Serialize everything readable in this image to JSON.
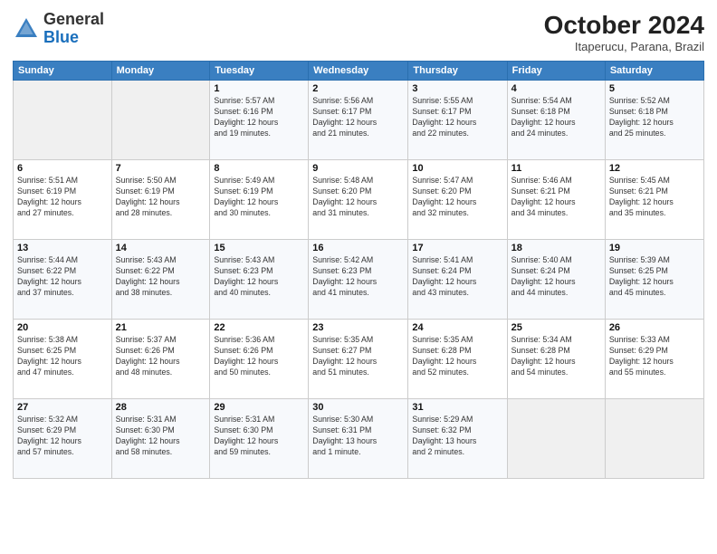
{
  "header": {
    "logo_general": "General",
    "logo_blue": "Blue",
    "month_year": "October 2024",
    "location": "Itaperucu, Parana, Brazil"
  },
  "weekdays": [
    "Sunday",
    "Monday",
    "Tuesday",
    "Wednesday",
    "Thursday",
    "Friday",
    "Saturday"
  ],
  "weeks": [
    [
      {
        "day": "",
        "info": ""
      },
      {
        "day": "",
        "info": ""
      },
      {
        "day": "1",
        "info": "Sunrise: 5:57 AM\nSunset: 6:16 PM\nDaylight: 12 hours\nand 19 minutes."
      },
      {
        "day": "2",
        "info": "Sunrise: 5:56 AM\nSunset: 6:17 PM\nDaylight: 12 hours\nand 21 minutes."
      },
      {
        "day": "3",
        "info": "Sunrise: 5:55 AM\nSunset: 6:17 PM\nDaylight: 12 hours\nand 22 minutes."
      },
      {
        "day": "4",
        "info": "Sunrise: 5:54 AM\nSunset: 6:18 PM\nDaylight: 12 hours\nand 24 minutes."
      },
      {
        "day": "5",
        "info": "Sunrise: 5:52 AM\nSunset: 6:18 PM\nDaylight: 12 hours\nand 25 minutes."
      }
    ],
    [
      {
        "day": "6",
        "info": "Sunrise: 5:51 AM\nSunset: 6:19 PM\nDaylight: 12 hours\nand 27 minutes."
      },
      {
        "day": "7",
        "info": "Sunrise: 5:50 AM\nSunset: 6:19 PM\nDaylight: 12 hours\nand 28 minutes."
      },
      {
        "day": "8",
        "info": "Sunrise: 5:49 AM\nSunset: 6:19 PM\nDaylight: 12 hours\nand 30 minutes."
      },
      {
        "day": "9",
        "info": "Sunrise: 5:48 AM\nSunset: 6:20 PM\nDaylight: 12 hours\nand 31 minutes."
      },
      {
        "day": "10",
        "info": "Sunrise: 5:47 AM\nSunset: 6:20 PM\nDaylight: 12 hours\nand 32 minutes."
      },
      {
        "day": "11",
        "info": "Sunrise: 5:46 AM\nSunset: 6:21 PM\nDaylight: 12 hours\nand 34 minutes."
      },
      {
        "day": "12",
        "info": "Sunrise: 5:45 AM\nSunset: 6:21 PM\nDaylight: 12 hours\nand 35 minutes."
      }
    ],
    [
      {
        "day": "13",
        "info": "Sunrise: 5:44 AM\nSunset: 6:22 PM\nDaylight: 12 hours\nand 37 minutes."
      },
      {
        "day": "14",
        "info": "Sunrise: 5:43 AM\nSunset: 6:22 PM\nDaylight: 12 hours\nand 38 minutes."
      },
      {
        "day": "15",
        "info": "Sunrise: 5:43 AM\nSunset: 6:23 PM\nDaylight: 12 hours\nand 40 minutes."
      },
      {
        "day": "16",
        "info": "Sunrise: 5:42 AM\nSunset: 6:23 PM\nDaylight: 12 hours\nand 41 minutes."
      },
      {
        "day": "17",
        "info": "Sunrise: 5:41 AM\nSunset: 6:24 PM\nDaylight: 12 hours\nand 43 minutes."
      },
      {
        "day": "18",
        "info": "Sunrise: 5:40 AM\nSunset: 6:24 PM\nDaylight: 12 hours\nand 44 minutes."
      },
      {
        "day": "19",
        "info": "Sunrise: 5:39 AM\nSunset: 6:25 PM\nDaylight: 12 hours\nand 45 minutes."
      }
    ],
    [
      {
        "day": "20",
        "info": "Sunrise: 5:38 AM\nSunset: 6:25 PM\nDaylight: 12 hours\nand 47 minutes."
      },
      {
        "day": "21",
        "info": "Sunrise: 5:37 AM\nSunset: 6:26 PM\nDaylight: 12 hours\nand 48 minutes."
      },
      {
        "day": "22",
        "info": "Sunrise: 5:36 AM\nSunset: 6:26 PM\nDaylight: 12 hours\nand 50 minutes."
      },
      {
        "day": "23",
        "info": "Sunrise: 5:35 AM\nSunset: 6:27 PM\nDaylight: 12 hours\nand 51 minutes."
      },
      {
        "day": "24",
        "info": "Sunrise: 5:35 AM\nSunset: 6:28 PM\nDaylight: 12 hours\nand 52 minutes."
      },
      {
        "day": "25",
        "info": "Sunrise: 5:34 AM\nSunset: 6:28 PM\nDaylight: 12 hours\nand 54 minutes."
      },
      {
        "day": "26",
        "info": "Sunrise: 5:33 AM\nSunset: 6:29 PM\nDaylight: 12 hours\nand 55 minutes."
      }
    ],
    [
      {
        "day": "27",
        "info": "Sunrise: 5:32 AM\nSunset: 6:29 PM\nDaylight: 12 hours\nand 57 minutes."
      },
      {
        "day": "28",
        "info": "Sunrise: 5:31 AM\nSunset: 6:30 PM\nDaylight: 12 hours\nand 58 minutes."
      },
      {
        "day": "29",
        "info": "Sunrise: 5:31 AM\nSunset: 6:30 PM\nDaylight: 12 hours\nand 59 minutes."
      },
      {
        "day": "30",
        "info": "Sunrise: 5:30 AM\nSunset: 6:31 PM\nDaylight: 13 hours\nand 1 minute."
      },
      {
        "day": "31",
        "info": "Sunrise: 5:29 AM\nSunset: 6:32 PM\nDaylight: 13 hours\nand 2 minutes."
      },
      {
        "day": "",
        "info": ""
      },
      {
        "day": "",
        "info": ""
      }
    ]
  ]
}
